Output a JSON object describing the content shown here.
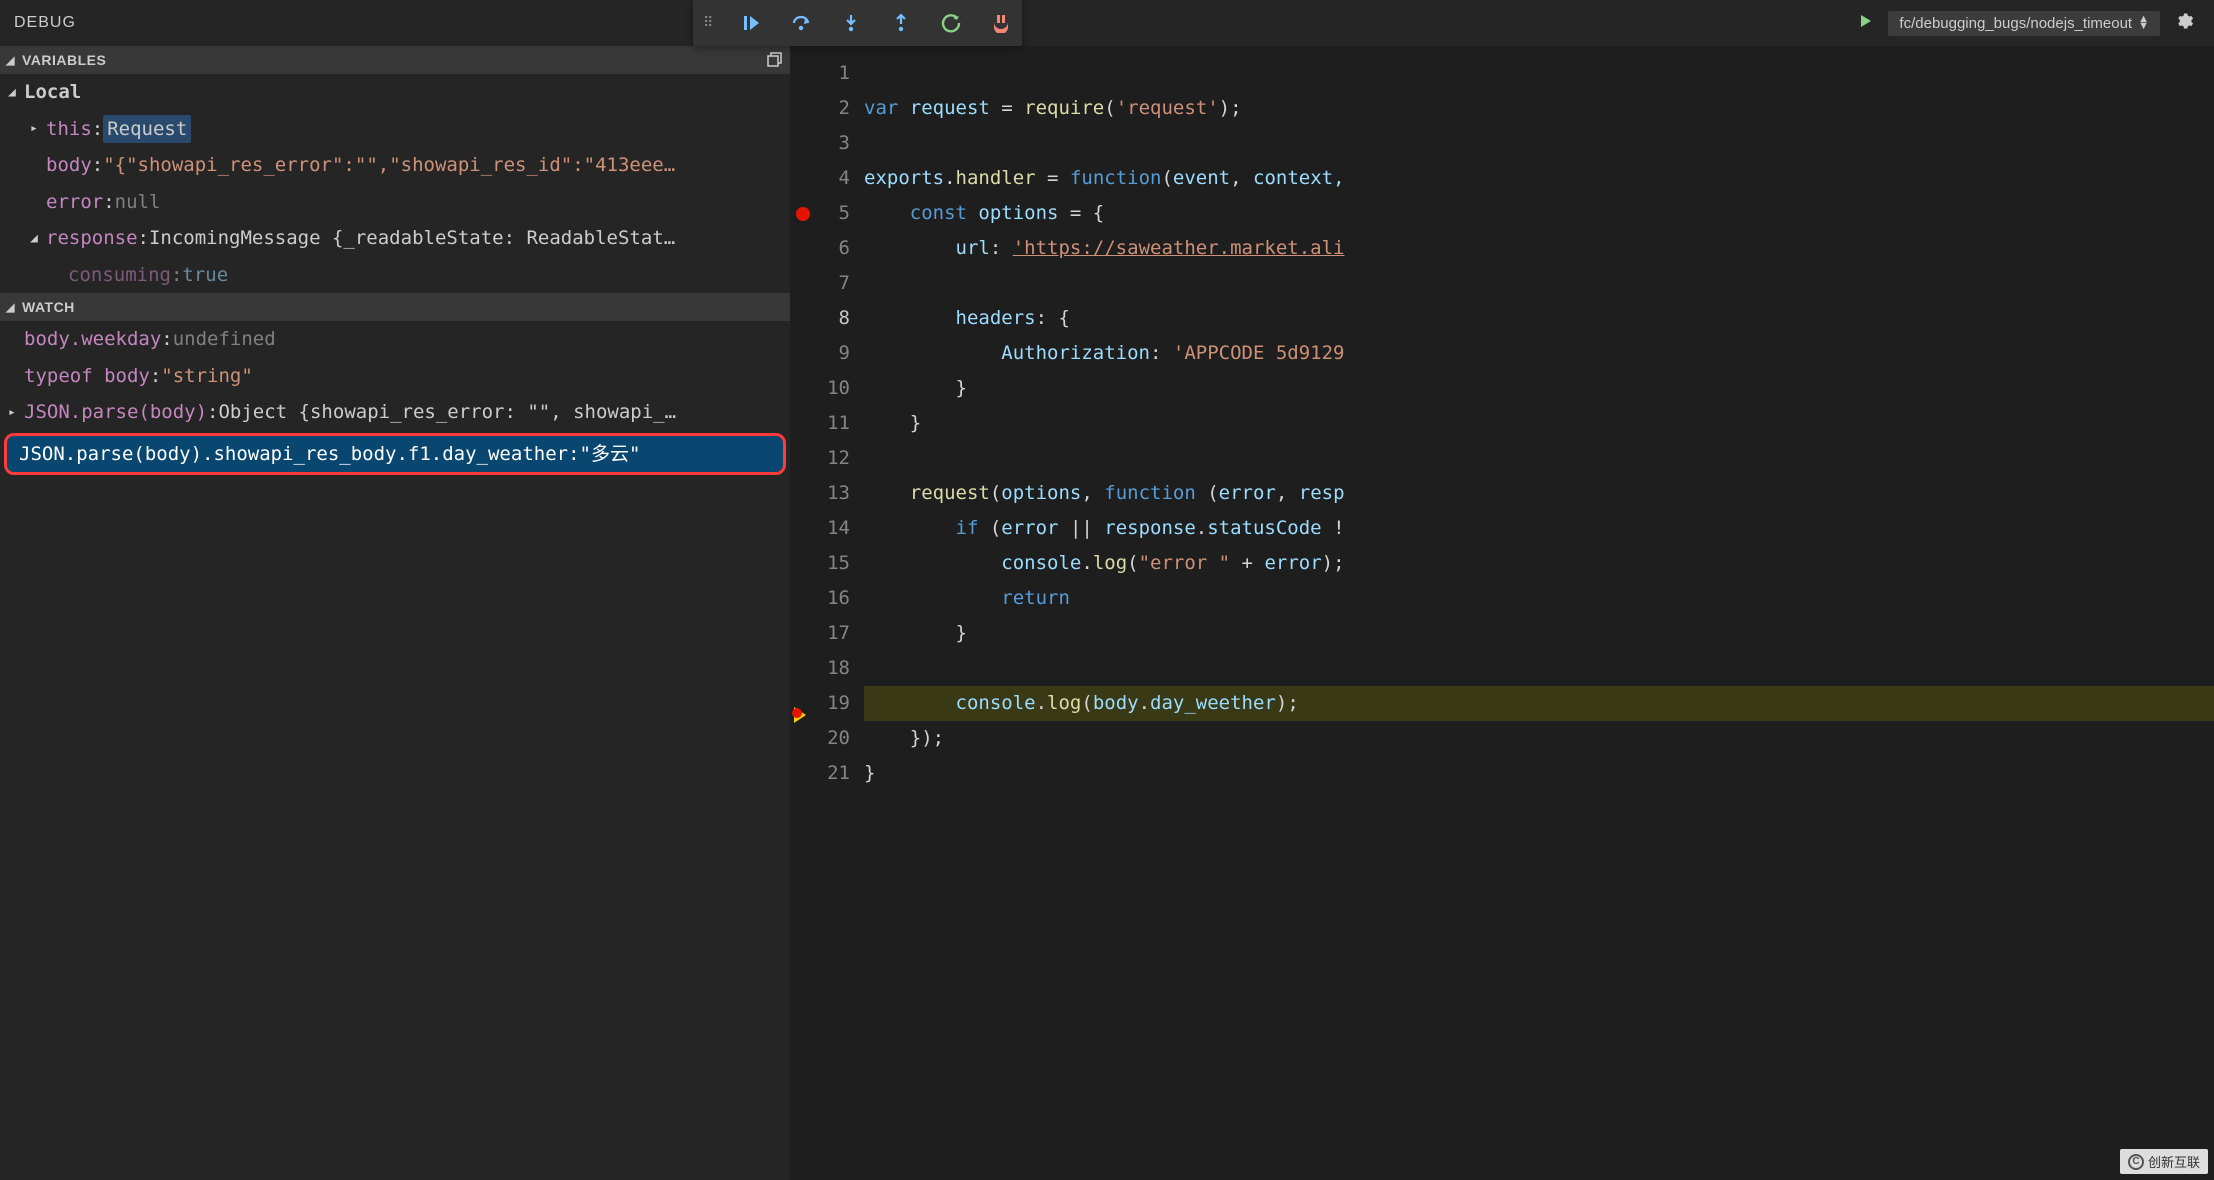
{
  "topbar": {
    "debug_label": "DEBUG",
    "config_name": "fc/debugging_bugs/nodejs_timeout"
  },
  "sections": {
    "variables_title": "VARIABLES",
    "watch_title": "WATCH",
    "local_scope": "Local"
  },
  "variables": {
    "this_name": "this",
    "this_value": "Request",
    "body_name": "body",
    "body_value": "\"{\"showapi_res_error\":\"\",\"showapi_res_id\":\"413eee…",
    "error_name": "error",
    "error_value": "null",
    "response_name": "response",
    "response_value": "IncomingMessage {_readableState: ReadableStat…",
    "consuming_name": "consuming",
    "consuming_value": "true"
  },
  "watch": {
    "w1_name": "body.weekday",
    "w1_value": "undefined",
    "w2_name": "typeof body",
    "w2_value": "\"string\"",
    "w3_name": "JSON.parse(body)",
    "w3_value": "Object {showapi_res_error: \"\", showapi_…",
    "w4_name": "JSON.parse(body).showapi_res_body.f1.day_weather",
    "w4_value": "\"多云\""
  },
  "editor": {
    "line_count": 21,
    "current_line": 8,
    "breakpoint_line": 5,
    "exec_line": 19,
    "lines": {
      "l1": "",
      "l2_kw": "var",
      "l2_id": " request ",
      "l2_eq": "= ",
      "l2_fn": "require",
      "l2_p1": "(",
      "l2_str": "'request'",
      "l2_p2": ");",
      "l3": "",
      "l4_a": "exports",
      "l4_b": ".",
      "l4_c": "handler",
      "l4_d": " = ",
      "l4_kw": "function",
      "l4_p1": "(",
      "l4_arg1": "event",
      "l4_cm": ", ",
      "l4_arg2": "context,",
      "l5_kw": "const",
      "l5_id": " options ",
      "l5_eq": "= {",
      "l6_prop": "url",
      "l6_c": ": ",
      "l6_str": "'https://saweather.market.ali",
      "l7": "",
      "l8_prop": "headers",
      "l8_c": ": {",
      "l9_prop": "Authorization",
      "l9_c": ": ",
      "l9_str": "'APPCODE 5d9129",
      "l10": "}",
      "l11": "}",
      "l12": "",
      "l13_fn": "request",
      "l13_p1": "(",
      "l13_a1": "options",
      "l13_cm": ", ",
      "l13_kw": "function",
      "l13_p2": " (",
      "l13_a2": "error",
      "l13_cm2": ", ",
      "l13_a3": "resp",
      "l14_kw": "if",
      "l14_p": " (",
      "l14_a": "error",
      "l14_op": " || ",
      "l14_b": "response",
      "l14_d": ".",
      "l14_c": "statusCode",
      "l14_ne": " !",
      "l15_a": "console",
      "l15_d": ".",
      "l15_fn": "log",
      "l15_p1": "(",
      "l15_str": "\"error \"",
      "l15_op": " + ",
      "l15_b": "error",
      "l15_p2": ");",
      "l16_kw": "return",
      "l17": "}",
      "l18": "",
      "l19_a": "console",
      "l19_d": ".",
      "l19_fn": "log",
      "l19_p1": "(",
      "l19_b": "body",
      "l19_d2": ".",
      "l19_c": "day_weether",
      "l19_p2": ");",
      "l20": "});",
      "l21": "}"
    }
  },
  "watermark": "创新互联"
}
